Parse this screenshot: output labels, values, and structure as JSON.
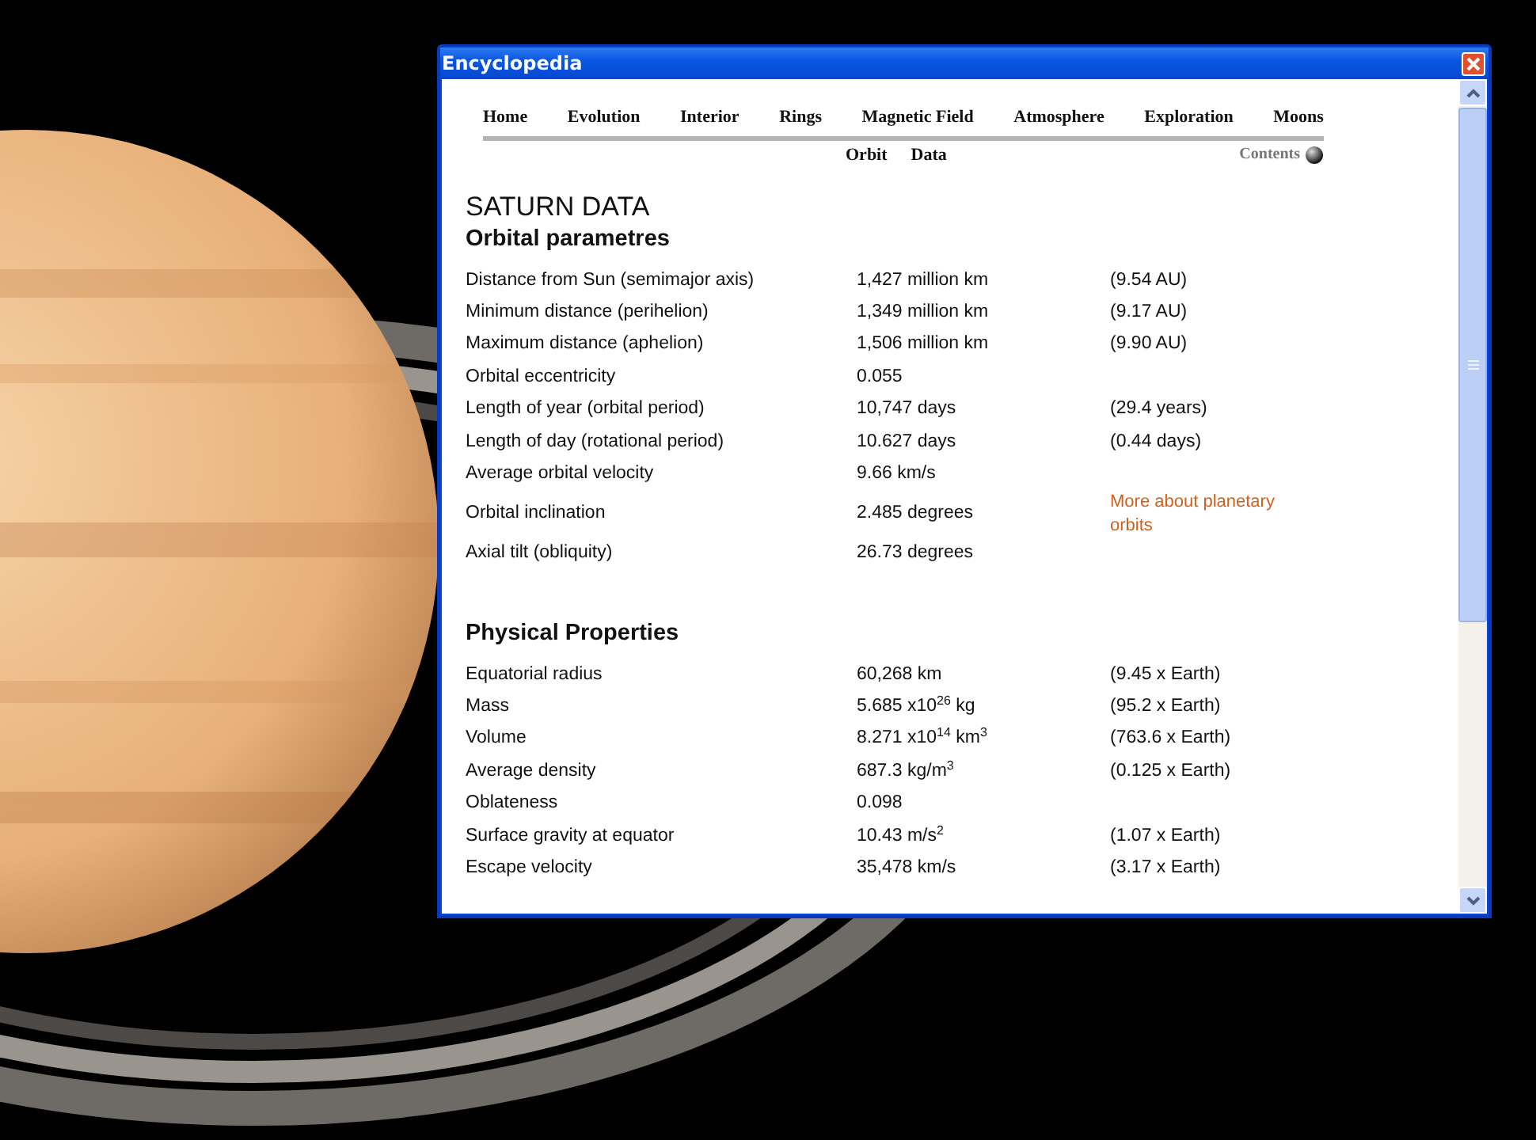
{
  "window": {
    "title": "Encyclopedia"
  },
  "nav": {
    "items": [
      {
        "label": "Home"
      },
      {
        "label": "Evolution"
      },
      {
        "label": "Interior"
      },
      {
        "label": "Rings"
      },
      {
        "label": "Magnetic Field"
      },
      {
        "label": "Atmosphere"
      },
      {
        "label": "Exploration"
      },
      {
        "label": "Moons"
      }
    ],
    "sub_items": [
      {
        "label": "Orbit"
      },
      {
        "label": "Data"
      }
    ],
    "contents_link": "Contents"
  },
  "page_title": "SATURN DATA",
  "sections": [
    {
      "heading": "Orbital parametres",
      "rows": [
        {
          "kind": "plain",
          "label": "Distance from Sun (semimajor axis)",
          "value": "1,427 million km",
          "note": "(9.54 AU)"
        },
        {
          "kind": "plain",
          "label": "Minimum distance (perihelion)",
          "value": "1,349 million km",
          "note": "(9.17 AU)"
        },
        {
          "kind": "plain",
          "label": "Maximum distance (aphelion)",
          "value": "1,506 million km",
          "note": "(9.90 AU)"
        },
        {
          "kind": "plain",
          "label": "Orbital eccentricity",
          "value": "0.055"
        },
        {
          "kind": "plain",
          "label": "Length of year (orbital period)",
          "value": "10,747 days",
          "note": "(29.4 years)"
        },
        {
          "kind": "plain",
          "label": "Length of day (rotational period)",
          "value": "10.627 days",
          "note": "(0.44 days)"
        },
        {
          "kind": "plain",
          "label": "Average orbital velocity",
          "value": "9.66 km/s"
        },
        {
          "kind": "link",
          "label": "Orbital inclination",
          "value": "2.485 degrees",
          "note": "More about planetary orbits"
        },
        {
          "kind": "plain",
          "label": "Axial tilt (obliquity)",
          "value": "26.73 degrees"
        }
      ]
    },
    {
      "heading": "Physical Properties",
      "rows": [
        {
          "kind": "plain",
          "label": "Equatorial radius",
          "value": "60,268 km",
          "note": "(9.45 x Earth)"
        },
        {
          "kind": "plain",
          "label": "Mass",
          "value": "5.685 x10$^{26}$ kg",
          "note": "(95.2 x Earth)"
        },
        {
          "kind": "plain",
          "label": "Volume",
          "value": "8.271 x10$^{14}$ km$^{3}$",
          "note": "(763.6 x Earth)"
        },
        {
          "kind": "plain",
          "label": "Average density",
          "value": "687.3 kg/m$^{3}$",
          "note": "(0.125 x Earth)"
        },
        {
          "kind": "plain",
          "label": "Oblateness",
          "value": "0.098"
        },
        {
          "kind": "plain",
          "label": "Surface gravity at equator",
          "value": "10.43 m/s$^{2}$",
          "note": "(1.07 x Earth)"
        },
        {
          "kind": "plain",
          "label": "Escape velocity",
          "value": "35,478 km/s",
          "note": "(3.17 x Earth)"
        }
      ]
    }
  ]
}
